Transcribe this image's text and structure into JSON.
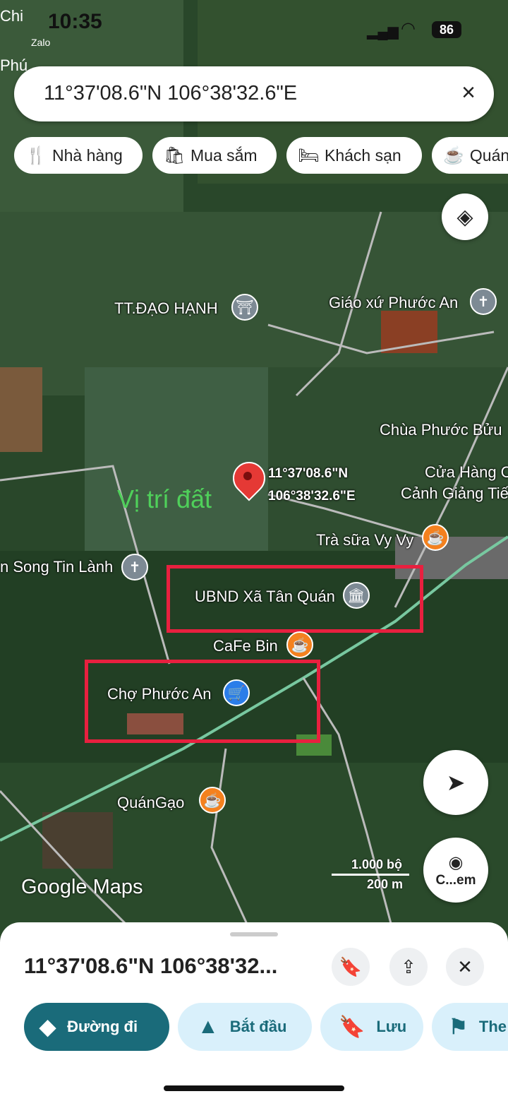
{
  "status": {
    "time": "10:35",
    "battery": "86",
    "bg_left_top": "Chi",
    "bg_left_zalo": "Zalo",
    "bg_left_phu": "Phú"
  },
  "search": {
    "text": "11°37'08.6\"N 106°38'32.6\"E",
    "close_icon": "×"
  },
  "chips": [
    {
      "icon": "restaurant-icon",
      "glyph": "🍴",
      "label": "Nhà hàng"
    },
    {
      "icon": "shopping-bag-icon",
      "glyph": "🛍",
      "label": "Mua sắm"
    },
    {
      "icon": "hotel-bed-icon",
      "glyph": "🛏",
      "label": "Khách sạn"
    },
    {
      "icon": "coffee-cup-icon",
      "glyph": "☕",
      "label": "Quán"
    }
  ],
  "map_labels": {
    "tt_dao_hanh": "TT.ĐẠO HẠNH",
    "giao_xu": "Giáo xứ Phước An",
    "chua": "Chùa Phước Bửu",
    "cua_hang_1": "Cửa Hàng C",
    "cua_hang_2": "Cảnh Giảng Tiế",
    "vi_tri": "Vị trí đất",
    "pin_coord_1": "11°37'08.6\"N",
    "pin_coord_2": "106°38'32.6\"E",
    "tra_sua": "Trà sữa Vy Vy",
    "song_tin_lanh": "n Song Tin Lành",
    "ubnd": "UBND Xã Tân Quán",
    "cafe_bin": "CaFe Bin",
    "cho": "Chợ Phước An",
    "quan_gao": "QuánGạo"
  },
  "scale": {
    "top": "1.000 bộ",
    "bottom": "200 m"
  },
  "branding": "Google Maps",
  "lens_label": "C...em",
  "sheet": {
    "coord": "11°37'08.6\"N 106°38'32...",
    "actions": [
      {
        "label": "Đường đi",
        "icon": "directions-icon"
      },
      {
        "label": "Bắt đầu",
        "icon": "navigation-arrow-icon"
      },
      {
        "label": "Lưu",
        "icon": "bookmark-icon"
      },
      {
        "label": "The",
        "icon": "flag-icon"
      }
    ]
  },
  "colors": {
    "accent": "#1a6b7a",
    "pill": "#d9f0fb",
    "red_box": "#e8203f",
    "pin_red": "#e53935",
    "orange": "#f4811f",
    "blue_pin": "#2b7de9",
    "gray_pin": "#7d8a94"
  }
}
